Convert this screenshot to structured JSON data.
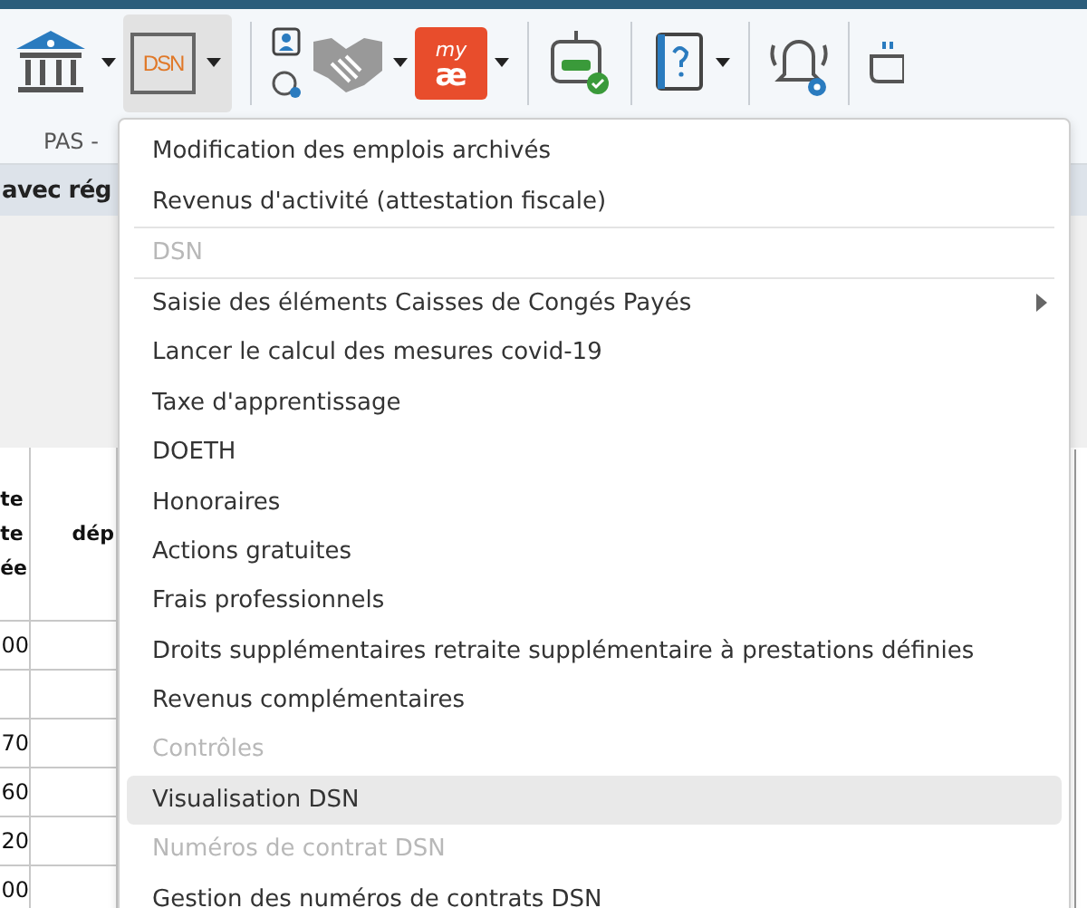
{
  "ribbon": {
    "dsn_logo": "DSN",
    "myae_logo_top": "my",
    "myae_logo_bottom": "æ",
    "group_label": "PAS -"
  },
  "section_title": "avec rég",
  "table": {
    "header": [
      "te\nte\née",
      "dép"
    ],
    "rows": [
      [
        "00",
        ""
      ],
      [
        "",
        ""
      ],
      [
        "70",
        ""
      ],
      [
        "60",
        ""
      ],
      [
        "20",
        ""
      ],
      [
        "00",
        ""
      ]
    ]
  },
  "menu": [
    {
      "kind": "item",
      "label": "Modification des emplois archivés",
      "disabled": false,
      "selected": false
    },
    {
      "kind": "item",
      "label": "Revenus d'activité (attestation fiscale)",
      "disabled": false,
      "selected": false
    },
    {
      "kind": "header",
      "label": "DSN"
    },
    {
      "kind": "submenu",
      "label": "Saisie des éléments Caisses de Congés Payés",
      "disabled": false,
      "selected": false
    },
    {
      "kind": "item",
      "label": "Lancer le calcul des mesures covid-19",
      "disabled": false,
      "selected": false
    },
    {
      "kind": "item",
      "label": "Taxe d'apprentissage",
      "disabled": false,
      "selected": false
    },
    {
      "kind": "item",
      "label": "DOETH",
      "disabled": false,
      "selected": false
    },
    {
      "kind": "item",
      "label": "Honoraires",
      "disabled": false,
      "selected": false
    },
    {
      "kind": "item",
      "label": "Actions gratuites",
      "disabled": false,
      "selected": false
    },
    {
      "kind": "item",
      "label": "Frais professionnels",
      "disabled": false,
      "selected": false
    },
    {
      "kind": "item",
      "label": "Droits supplémentaires retraite supplémentaire à prestations définies",
      "disabled": false,
      "selected": false
    },
    {
      "kind": "item",
      "label": "Revenus complémentaires",
      "disabled": false,
      "selected": false
    },
    {
      "kind": "item",
      "label": "Contrôles",
      "disabled": true,
      "selected": false
    },
    {
      "kind": "item",
      "label": "Visualisation DSN",
      "disabled": false,
      "selected": true
    },
    {
      "kind": "item",
      "label": "Numéros de contrat DSN",
      "disabled": true,
      "selected": false
    },
    {
      "kind": "item",
      "label": "Gestion des numéros de contrats DSN",
      "disabled": false,
      "selected": false
    }
  ]
}
